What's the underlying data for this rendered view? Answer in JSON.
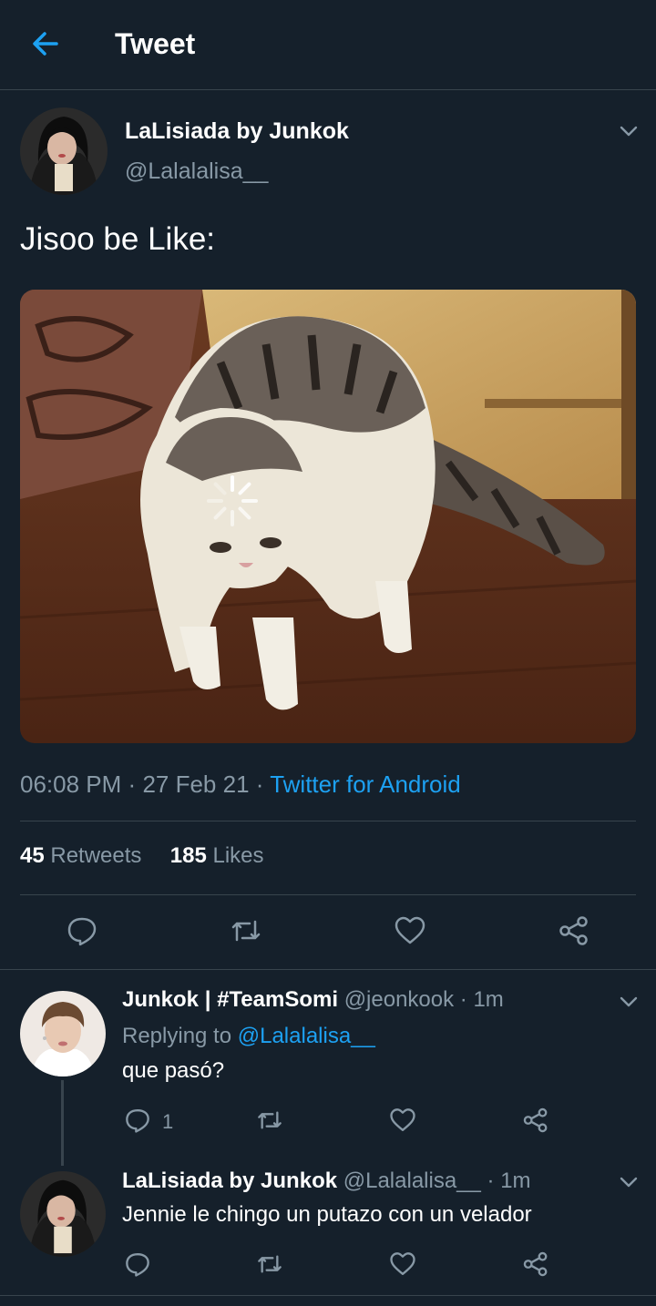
{
  "header": {
    "title": "Tweet",
    "back_icon": "arrow-left-icon"
  },
  "tweet": {
    "author_name": "LaLisiada by Junkok",
    "handle": "@Lalalalisa__",
    "text": "Jisoo be Like:",
    "time": "06:08 PM",
    "date": "27 Feb 21",
    "separator": "·",
    "source": "Twitter for Android",
    "retweets_count": "45",
    "retweets_label": "Retweets",
    "likes_count": "185",
    "likes_label": "Likes"
  },
  "replies": [
    {
      "author_name": "Junkok | #TeamSomi",
      "handle": "@jeonkook",
      "time": "· 1m",
      "replying_prefix": "Replying to",
      "replying_handle": "@Lalalalisa__",
      "text": "que pasó?",
      "reply_count": "1"
    },
    {
      "author_name": "LaLisiada by Junkok",
      "handle": "@Lalalalisa__",
      "time": "· 1m",
      "text": "Jennie le chingo un putazo con un velador"
    }
  ],
  "colors": {
    "background": "#15202b",
    "accent": "#1da1f2",
    "muted": "#8899a6",
    "divider": "#38444d"
  }
}
